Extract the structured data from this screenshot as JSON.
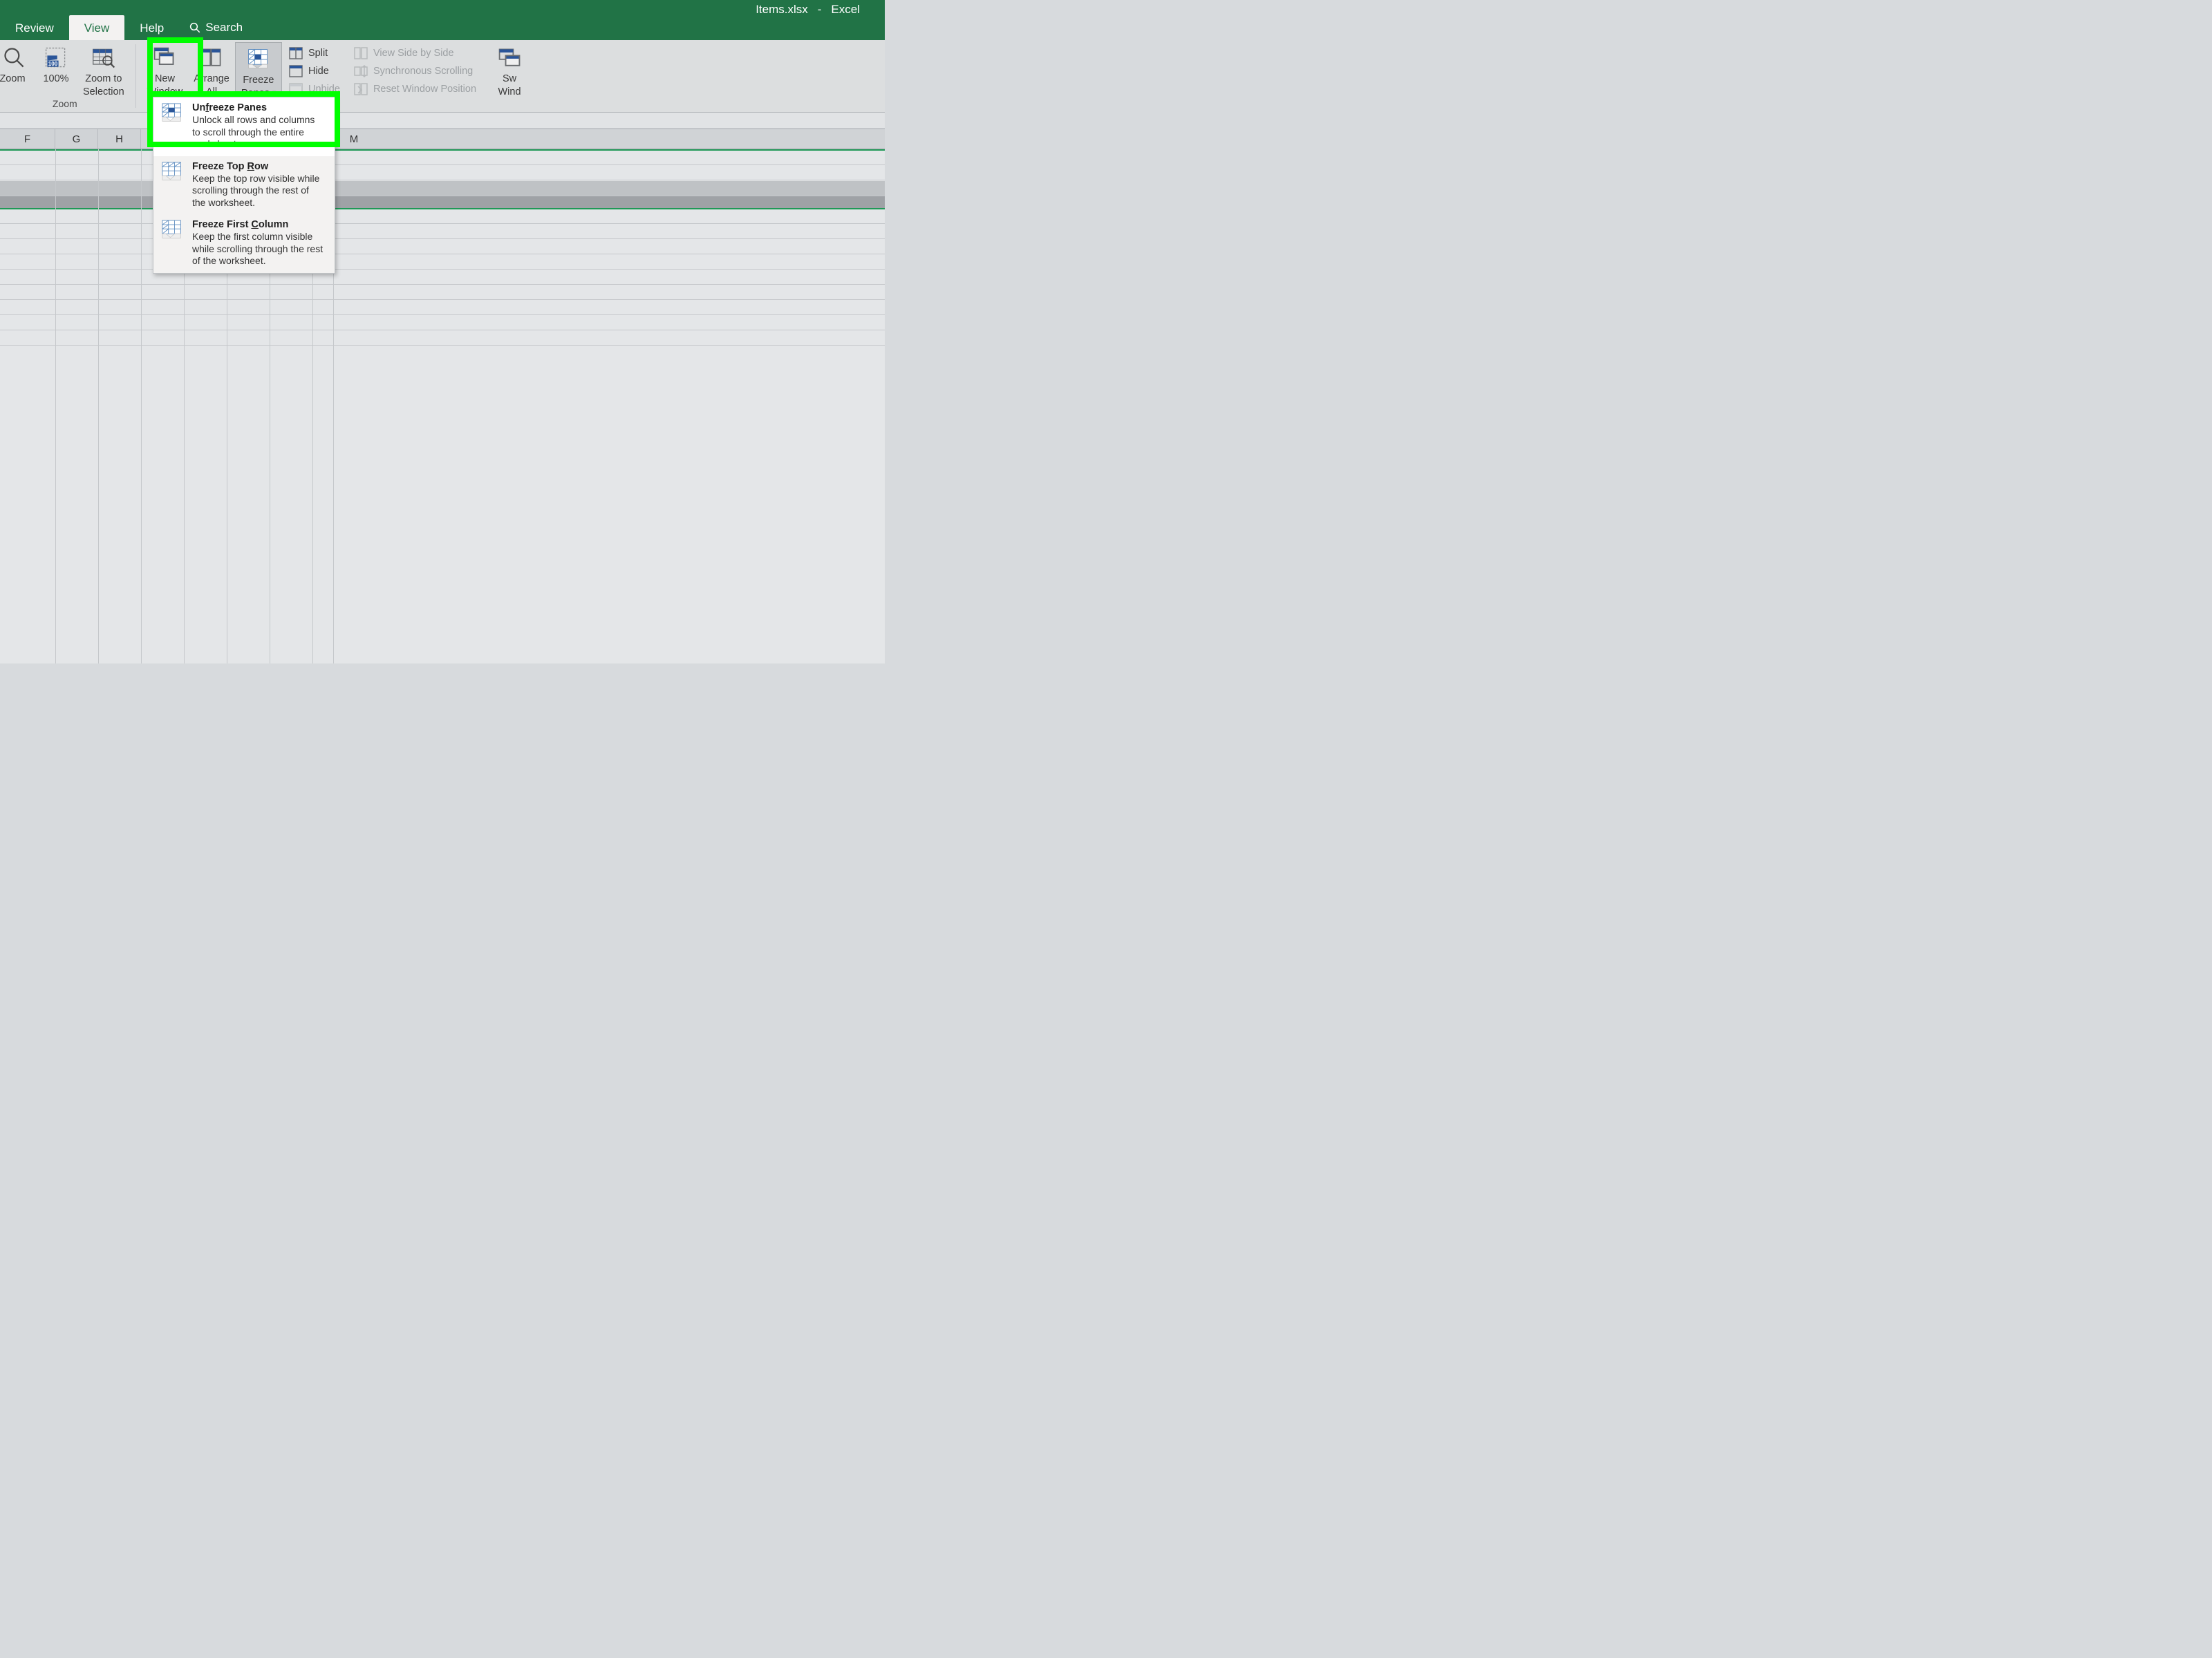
{
  "title": {
    "filename": "Items.xlsx",
    "sep": "-",
    "app": "Excel"
  },
  "tabs": {
    "review": "Review",
    "view": "View",
    "help": "Help",
    "search": "Search"
  },
  "ribbon": {
    "zoom_group_label": "Zoom",
    "zoom_btn": "Zoom",
    "hundred_btn": "100%",
    "zoom_selection_l1": "Zoom to",
    "zoom_selection_l2": "Selection",
    "new_window_l1": "New",
    "new_window_l2": "Window",
    "arrange_all_l1": "Arrange",
    "arrange_all_l2": "All",
    "freeze_l1": "Freeze",
    "freeze_l2": "Panes",
    "split": "Split",
    "hide": "Hide",
    "unhide": "Unhide",
    "view_side": "View Side by Side",
    "sync_scroll": "Synchronous Scrolling",
    "reset_pos": "Reset Window Position",
    "switch_l1": "Sw",
    "switch_l2": "Wind"
  },
  "dropdown": {
    "unfreeze_title": "Unfreeze Panes",
    "unfreeze_desc": "Unlock all rows and columns to scroll through the entire worksheet.",
    "toprow_title": "Freeze Top Row",
    "toprow_desc": "Keep the top row visible while scrolling through the rest of the worksheet.",
    "firstcol_title": "Freeze First Column",
    "firstcol_desc": "Keep the first column visible while scrolling through the rest of the worksheet."
  },
  "columns": [
    "F",
    "G",
    "H",
    "M"
  ],
  "colors": {
    "excel_green": "#217346",
    "highlight": "#00ff00"
  }
}
